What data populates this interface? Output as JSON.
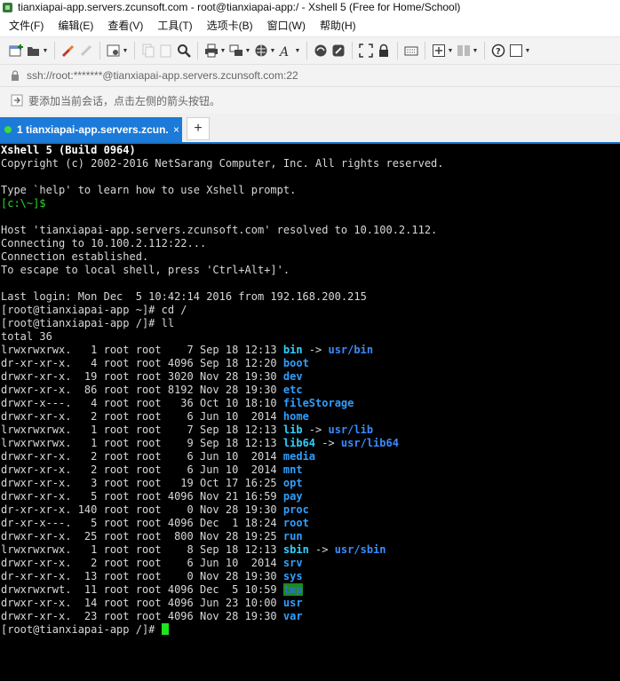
{
  "window": {
    "title": "tianxiapai-app.servers.zcunsoft.com - root@tianxiapai-app:/ - Xshell 5 (Free for Home/School)"
  },
  "menu": [
    "文件(F)",
    "编辑(E)",
    "查看(V)",
    "工具(T)",
    "选项卡(B)",
    "窗口(W)",
    "帮助(H)"
  ],
  "address": {
    "text": "ssh://root:*******@tianxiapai-app.servers.zcunsoft.com:22"
  },
  "infobar": {
    "text": "要添加当前会话，点击左侧的箭头按钮。"
  },
  "tab": {
    "label": "1 tianxiapai-app.servers.zcun...",
    "close": "×",
    "add": "+"
  },
  "terminal": {
    "banner_title": "Xshell 5 (Build 0964)",
    "copyright": "Copyright (c) 2002-2016 NetSarang Computer, Inc. All rights reserved.",
    "help_line": "Type `help' to learn how to use Xshell prompt.",
    "local_prompt": "[c:\\~]$",
    "host_line": "Host 'tianxiapai-app.servers.zcunsoft.com' resolved to 10.100.2.112.",
    "connecting": "Connecting to 10.100.2.112:22...",
    "established": "Connection established.",
    "escape_hint": "To escape to local shell, press 'Ctrl+Alt+]'.",
    "last_login": "Last login: Mon Dec  5 10:42:14 2016 from 192.168.200.215",
    "cmd1": "[root@tianxiapai-app ~]# cd /",
    "cmd2": "[root@tianxiapai-app /]# ll",
    "total": "total 36",
    "listing": [
      {
        "meta": "lrwxrwxrwx.   1 root root    7 Sep 18 12:13 ",
        "name": "bin",
        "kind": "link",
        "target": "usr/bin"
      },
      {
        "meta": "dr-xr-xr-x.   4 root root 4096 Sep 18 12:20 ",
        "name": "boot",
        "kind": "dir",
        "target": ""
      },
      {
        "meta": "drwxr-xr-x.  19 root root 3020 Nov 28 19:30 ",
        "name": "dev",
        "kind": "dir",
        "target": ""
      },
      {
        "meta": "drwxr-xr-x.  86 root root 8192 Nov 28 19:30 ",
        "name": "etc",
        "kind": "dir",
        "target": ""
      },
      {
        "meta": "drwxr-x---.   4 root root   36 Oct 10 18:10 ",
        "name": "fileStorage",
        "kind": "dir",
        "target": ""
      },
      {
        "meta": "drwxr-xr-x.   2 root root    6 Jun 10  2014 ",
        "name": "home",
        "kind": "dir",
        "target": ""
      },
      {
        "meta": "lrwxrwxrwx.   1 root root    7 Sep 18 12:13 ",
        "name": "lib",
        "kind": "link",
        "target": "usr/lib"
      },
      {
        "meta": "lrwxrwxrwx.   1 root root    9 Sep 18 12:13 ",
        "name": "lib64",
        "kind": "link",
        "target": "usr/lib64"
      },
      {
        "meta": "drwxr-xr-x.   2 root root    6 Jun 10  2014 ",
        "name": "media",
        "kind": "dir",
        "target": ""
      },
      {
        "meta": "drwxr-xr-x.   2 root root    6 Jun 10  2014 ",
        "name": "mnt",
        "kind": "dir",
        "target": ""
      },
      {
        "meta": "drwxr-xr-x.   3 root root   19 Oct 17 16:25 ",
        "name": "opt",
        "kind": "dir",
        "target": ""
      },
      {
        "meta": "drwxr-xr-x.   5 root root 4096 Nov 21 16:59 ",
        "name": "pay",
        "kind": "dir",
        "target": ""
      },
      {
        "meta": "dr-xr-xr-x. 140 root root    0 Nov 28 19:30 ",
        "name": "proc",
        "kind": "dir",
        "target": ""
      },
      {
        "meta": "dr-xr-x---.   5 root root 4096 Dec  1 18:24 ",
        "name": "root",
        "kind": "dir",
        "target": ""
      },
      {
        "meta": "drwxr-xr-x.  25 root root  800 Nov 28 19:25 ",
        "name": "run",
        "kind": "dir",
        "target": ""
      },
      {
        "meta": "lrwxrwxrwx.   1 root root    8 Sep 18 12:13 ",
        "name": "sbin",
        "kind": "link",
        "target": "usr/sbin"
      },
      {
        "meta": "drwxr-xr-x.   2 root root    6 Jun 10  2014 ",
        "name": "srv",
        "kind": "dir",
        "target": ""
      },
      {
        "meta": "dr-xr-xr-x.  13 root root    0 Nov 28 19:30 ",
        "name": "sys",
        "kind": "dir",
        "target": ""
      },
      {
        "meta": "drwxrwxrwt.  11 root root 4096 Dec  5 10:59 ",
        "name": "tmp",
        "kind": "sticky",
        "target": ""
      },
      {
        "meta": "drwxr-xr-x.  14 root root 4096 Jun 23 10:00 ",
        "name": "usr",
        "kind": "dir",
        "target": ""
      },
      {
        "meta": "drwxr-xr-x.  23 root root 4096 Nov 28 19:30 ",
        "name": "var",
        "kind": "dir",
        "target": ""
      }
    ],
    "arrow": " -> ",
    "final_prompt": "[root@tianxiapai-app /]# "
  }
}
